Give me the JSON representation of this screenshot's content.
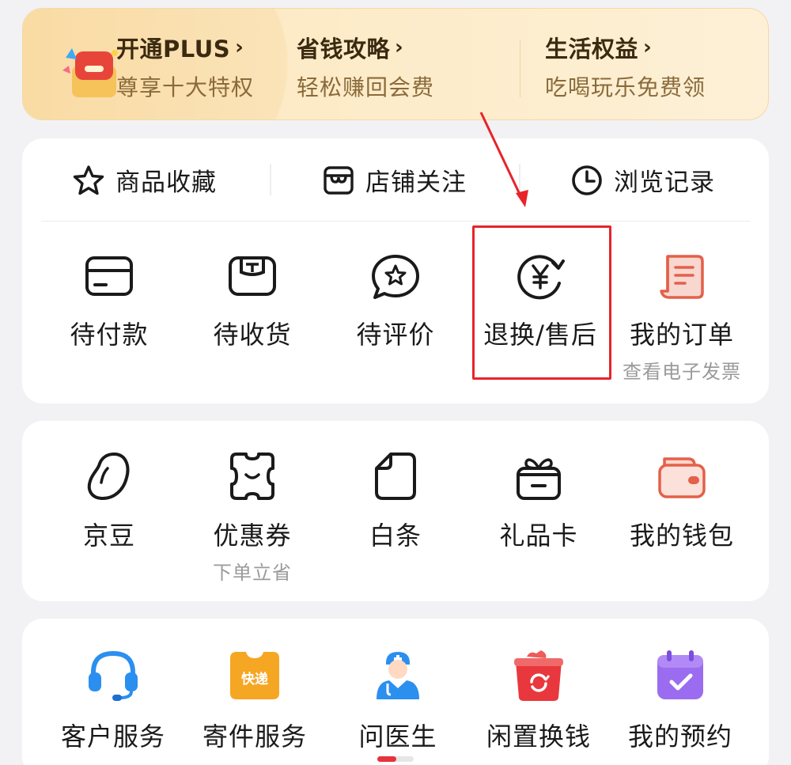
{
  "plus_banner": {
    "items": [
      {
        "title": "开通PLUS",
        "subtitle": "尊享十大特权"
      },
      {
        "title": "省钱攻略",
        "subtitle": "轻松赚回会费"
      },
      {
        "title": "生活权益",
        "subtitle": "吃喝玩乐免费领"
      }
    ],
    "chevron": "›"
  },
  "quick_links": [
    {
      "label": "商品收藏",
      "icon": "star-icon"
    },
    {
      "label": "店铺关注",
      "icon": "shop-icon"
    },
    {
      "label": "浏览记录",
      "icon": "clock-icon"
    }
  ],
  "orders": [
    {
      "label": "待付款",
      "icon": "card-icon"
    },
    {
      "label": "待收货",
      "icon": "package-icon"
    },
    {
      "label": "待评价",
      "icon": "review-icon"
    },
    {
      "label": "退换/售后",
      "icon": "refund-yen-icon"
    },
    {
      "label": "我的订单",
      "sub": "查看电子发票",
      "icon": "order-list-icon"
    }
  ],
  "assets": [
    {
      "label": "京豆",
      "icon": "bean-icon"
    },
    {
      "label": "优惠券",
      "sub": "下单立省",
      "icon": "coupon-icon"
    },
    {
      "label": "白条",
      "icon": "baitiao-icon"
    },
    {
      "label": "礼品卡",
      "icon": "gift-card-icon"
    },
    {
      "label": "我的钱包",
      "icon": "wallet-icon"
    }
  ],
  "services": [
    {
      "label": "客户服务",
      "icon": "headset-icon"
    },
    {
      "label": "寄件服务",
      "icon": "express-icon",
      "badge": "快递"
    },
    {
      "label": "问医生",
      "icon": "doctor-icon"
    },
    {
      "label": "闲置换钱",
      "icon": "recycle-icon"
    },
    {
      "label": "我的预约",
      "icon": "calendar-check-icon"
    }
  ],
  "colors": {
    "accent": "#e8232a",
    "plus_text": "#3b2a10",
    "plus_sub": "#8a6a3a"
  }
}
